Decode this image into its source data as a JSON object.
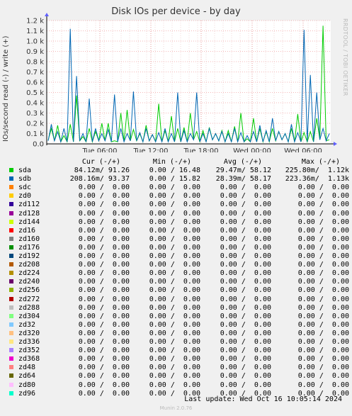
{
  "chart_data": {
    "type": "line",
    "title": "Disk IOs per device - by day",
    "ylabel": "IOs/second read (-) / write (+)",
    "ylim": [
      0,
      1200
    ],
    "yticks": [
      "0.0",
      "0.1 k",
      "0.2 k",
      "0.3 k",
      "0.4 k",
      "0.5 k",
      "0.6 k",
      "0.7 k",
      "0.8 k",
      "0.9 k",
      "1.0 k",
      "1.1 k",
      "1.2 k"
    ],
    "xticks": [
      "Tue 06:00",
      "Tue 12:00",
      "Tue 18:00",
      "Wed 00:00",
      "Wed 06:00"
    ],
    "grid": true,
    "series": [
      {
        "name": "sda",
        "color": "#00cc00",
        "values": [
          35,
          150,
          30,
          180,
          20,
          80,
          20,
          190,
          20,
          470,
          30,
          70,
          20,
          150,
          20,
          120,
          30,
          200,
          30,
          200,
          20,
          30,
          20,
          300,
          20,
          330,
          30,
          140,
          30,
          100,
          20,
          180,
          30,
          90,
          20,
          390,
          20,
          130,
          20,
          270,
          20,
          150,
          20,
          160,
          20,
          300,
          40,
          120,
          20,
          130,
          20,
          160,
          40,
          100,
          30,
          130,
          20,
          130,
          20,
          170,
          20,
          300,
          20,
          50,
          20,
          250,
          20,
          150,
          20,
          120,
          20,
          150,
          30,
          120,
          40,
          100,
          20,
          150,
          20,
          290,
          20,
          110,
          20,
          120,
          20,
          250,
          40,
          1150,
          30,
          40
        ]
      },
      {
        "name": "sdb",
        "color": "#0066b3",
        "values": [
          30,
          190,
          30,
          120,
          20,
          150,
          20,
          1120,
          20,
          660,
          30,
          100,
          20,
          440,
          20,
          150,
          30,
          100,
          30,
          140,
          20,
          480,
          20,
          150,
          20,
          100,
          30,
          510,
          30,
          110,
          20,
          150,
          30,
          90,
          20,
          110,
          20,
          150,
          20,
          100,
          20,
          500,
          20,
          130,
          20,
          100,
          40,
          500,
          20,
          100,
          20,
          150,
          40,
          100,
          30,
          120,
          20,
          100,
          20,
          150,
          20,
          110,
          20,
          80,
          20,
          120,
          20,
          180,
          20,
          130,
          20,
          250,
          30,
          120,
          40,
          100,
          20,
          190,
          20,
          110,
          20,
          1110,
          20,
          670,
          20,
          500,
          40,
          150,
          30,
          100
        ]
      }
    ],
    "table_headers": [
      "Cur (-/+)",
      "Min (-/+)",
      "Avg (-/+)",
      "Max (-/+)"
    ],
    "legend": [
      {
        "name": "sda",
        "color": "#00cc00",
        "cur": "84.12m/ 91.26",
        "min": "0.00 / 16.48",
        "avg": "29.47m/ 58.12",
        "max": "225.80m/  1.12k"
      },
      {
        "name": "sdb",
        "color": "#0066b3",
        "cur": "208.16m/ 93.37",
        "min": "0.00 / 15.82",
        "avg": "28.39m/ 58.17",
        "max": "223.36m/  1.13k"
      },
      {
        "name": "sdc",
        "color": "#ff8000",
        "cur": "0.00 /  0.00",
        "min": "0.00 /  0.00",
        "avg": "0.00 /  0.00",
        "max": "0.00 /  0.00"
      },
      {
        "name": "zd0",
        "color": "#ffcc00",
        "cur": "0.00 /  0.00",
        "min": "0.00 /  0.00",
        "avg": "0.00 /  0.00",
        "max": "0.00 /  0.00"
      },
      {
        "name": "zd112",
        "color": "#330099",
        "cur": "0.00 /  0.00",
        "min": "0.00 /  0.00",
        "avg": "0.00 /  0.00",
        "max": "0.00 /  0.00"
      },
      {
        "name": "zd128",
        "color": "#990099",
        "cur": "0.00 /  0.00",
        "min": "0.00 /  0.00",
        "avg": "0.00 /  0.00",
        "max": "0.00 /  0.00"
      },
      {
        "name": "zd144",
        "color": "#ccff00",
        "cur": "0.00 /  0.00",
        "min": "0.00 /  0.00",
        "avg": "0.00 /  0.00",
        "max": "0.00 /  0.00"
      },
      {
        "name": "zd16",
        "color": "#ff0000",
        "cur": "0.00 /  0.00",
        "min": "0.00 /  0.00",
        "avg": "0.00 /  0.00",
        "max": "0.00 /  0.00"
      },
      {
        "name": "zd160",
        "color": "#808080",
        "cur": "0.00 /  0.00",
        "min": "0.00 /  0.00",
        "avg": "0.00 /  0.00",
        "max": "0.00 /  0.00"
      },
      {
        "name": "zd176",
        "color": "#008f00",
        "cur": "0.00 /  0.00",
        "min": "0.00 /  0.00",
        "avg": "0.00 /  0.00",
        "max": "0.00 /  0.00"
      },
      {
        "name": "zd192",
        "color": "#00487d",
        "cur": "0.00 /  0.00",
        "min": "0.00 /  0.00",
        "avg": "0.00 /  0.00",
        "max": "0.00 /  0.00"
      },
      {
        "name": "zd208",
        "color": "#b35a00",
        "cur": "0.00 /  0.00",
        "min": "0.00 /  0.00",
        "avg": "0.00 /  0.00",
        "max": "0.00 /  0.00"
      },
      {
        "name": "zd224",
        "color": "#b38f00",
        "cur": "0.00 /  0.00",
        "min": "0.00 /  0.00",
        "avg": "0.00 /  0.00",
        "max": "0.00 /  0.00"
      },
      {
        "name": "zd240",
        "color": "#6b006b",
        "cur": "0.00 /  0.00",
        "min": "0.00 /  0.00",
        "avg": "0.00 /  0.00",
        "max": "0.00 /  0.00"
      },
      {
        "name": "zd256",
        "color": "#8fb300",
        "cur": "0.00 /  0.00",
        "min": "0.00 /  0.00",
        "avg": "0.00 /  0.00",
        "max": "0.00 /  0.00"
      },
      {
        "name": "zd272",
        "color": "#b30000",
        "cur": "0.00 /  0.00",
        "min": "0.00 /  0.00",
        "avg": "0.00 /  0.00",
        "max": "0.00 /  0.00"
      },
      {
        "name": "zd288",
        "color": "#bebebe",
        "cur": "0.00 /  0.00",
        "min": "0.00 /  0.00",
        "avg": "0.00 /  0.00",
        "max": "0.00 /  0.00"
      },
      {
        "name": "zd304",
        "color": "#80ff80",
        "cur": "0.00 /  0.00",
        "min": "0.00 /  0.00",
        "avg": "0.00 /  0.00",
        "max": "0.00 /  0.00"
      },
      {
        "name": "zd32",
        "color": "#80c9ff",
        "cur": "0.00 /  0.00",
        "min": "0.00 /  0.00",
        "avg": "0.00 /  0.00",
        "max": "0.00 /  0.00"
      },
      {
        "name": "zd320",
        "color": "#ffc080",
        "cur": "0.00 /  0.00",
        "min": "0.00 /  0.00",
        "avg": "0.00 /  0.00",
        "max": "0.00 /  0.00"
      },
      {
        "name": "zd336",
        "color": "#ffe680",
        "cur": "0.00 /  0.00",
        "min": "0.00 /  0.00",
        "avg": "0.00 /  0.00",
        "max": "0.00 /  0.00"
      },
      {
        "name": "zd352",
        "color": "#aa80ff",
        "cur": "0.00 /  0.00",
        "min": "0.00 /  0.00",
        "avg": "0.00 /  0.00",
        "max": "0.00 /  0.00"
      },
      {
        "name": "zd368",
        "color": "#ee00cc",
        "cur": "0.00 /  0.00",
        "min": "0.00 /  0.00",
        "avg": "0.00 /  0.00",
        "max": "0.00 /  0.00"
      },
      {
        "name": "zd48",
        "color": "#ff8080",
        "cur": "0.00 /  0.00",
        "min": "0.00 /  0.00",
        "avg": "0.00 /  0.00",
        "max": "0.00 /  0.00"
      },
      {
        "name": "zd64",
        "color": "#666600",
        "cur": "0.00 /  0.00",
        "min": "0.00 /  0.00",
        "avg": "0.00 /  0.00",
        "max": "0.00 /  0.00"
      },
      {
        "name": "zd80",
        "color": "#ffbfff",
        "cur": "0.00 /  0.00",
        "min": "0.00 /  0.00",
        "avg": "0.00 /  0.00",
        "max": "0.00 /  0.00"
      },
      {
        "name": "zd96",
        "color": "#00ffcc",
        "cur": "0.00 /  0.00",
        "min": "0.00 /  0.00",
        "avg": "0.00 /  0.00",
        "max": "0.00 /  0.00"
      }
    ]
  },
  "watermark": "RRDTOOL / TOBI OETIKER",
  "footer": "Last update: Wed Oct 16 10:05:14 2024",
  "version": "Munin 2.0.76"
}
